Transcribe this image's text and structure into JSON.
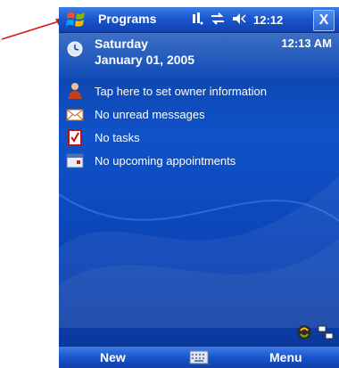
{
  "titlebar": {
    "title": "Programs",
    "time": "12:12",
    "close_label": "X"
  },
  "today": {
    "day": "Saturday",
    "date": "January 01, 2005",
    "time": "12:13 AM"
  },
  "items": [
    {
      "label": "Tap here to set owner information",
      "icon": "owner-icon"
    },
    {
      "label": "No unread messages",
      "icon": "envelope-icon"
    },
    {
      "label": "No tasks",
      "icon": "tasks-icon"
    },
    {
      "label": "No upcoming appointments",
      "icon": "calendar-icon"
    }
  ],
  "softkeys": {
    "left": "New",
    "right": "Menu"
  },
  "colors": {
    "annotation_arrow": "#e01010",
    "background": "#1052c8"
  }
}
